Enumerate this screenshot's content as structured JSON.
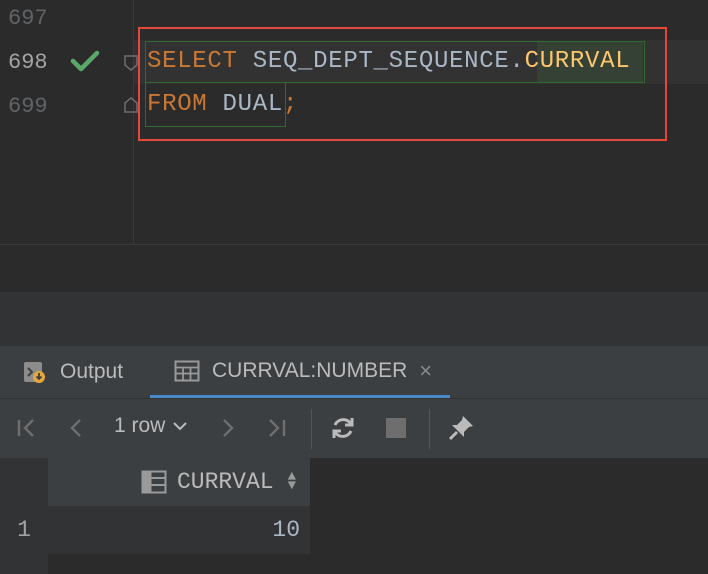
{
  "editor": {
    "line_numbers": [
      "697",
      "698",
      "699"
    ],
    "active_line": "698",
    "status_icon": "check-icon",
    "code": {
      "line1": {
        "keyword": "SELECT",
        "space": " ",
        "object": "SEQ_DEPT_SEQUENCE",
        "dot": ".",
        "field": "CURRVAL"
      },
      "line2": {
        "keyword": "FROM",
        "space": " ",
        "table": "DUAL",
        "semicolon": ";"
      }
    },
    "colors": {
      "keyword": "#cc7832",
      "identifier": "#a9b7c6",
      "field": "#ffc66d",
      "selection_outline": "#e5473a",
      "success": "#59a869"
    }
  },
  "tabs": [
    {
      "label": "Output",
      "icon": "output-console-icon",
      "active": false
    },
    {
      "label": "CURRVAL:NUMBER",
      "icon": "table-grid-icon",
      "active": true,
      "close": "×"
    }
  ],
  "toolbar": {
    "first_icon": "first-page-icon",
    "prev_icon": "previous-page-icon",
    "rows_label": "1 row",
    "rows_chevron": "chevron-down-icon",
    "next_icon": "next-page-icon",
    "last_icon": "last-page-icon",
    "reload_icon": "refresh-icon",
    "stop_icon": "stop-icon",
    "pin_icon": "pin-icon"
  },
  "result_grid": {
    "columns": [
      "CURRVAL"
    ],
    "column_icon": "column-table-icon",
    "sort_icon": "sort-updown-icon",
    "rows": [
      {
        "row_number": "1",
        "values": [
          "10"
        ]
      }
    ]
  }
}
